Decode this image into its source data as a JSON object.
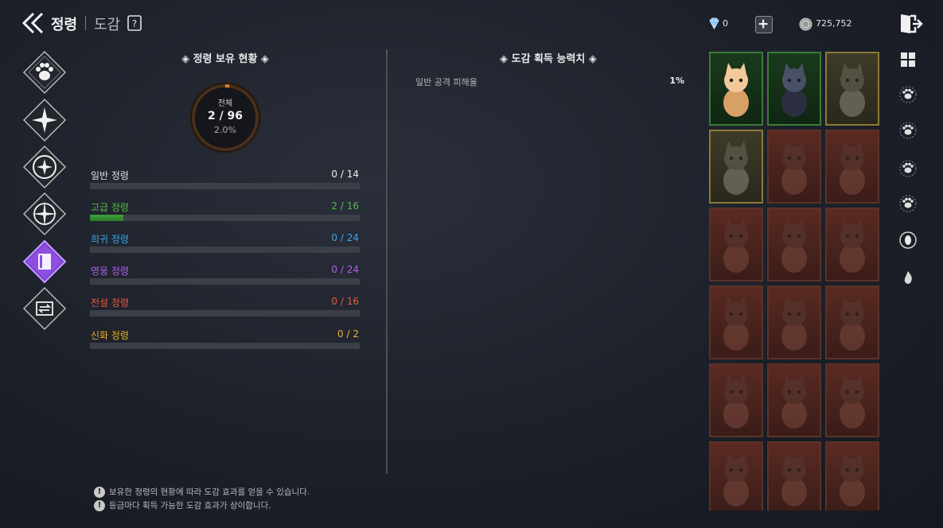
{
  "header": {
    "title": "정령",
    "subtitle": "도감",
    "gem_value": "0",
    "coin_value": "725,752"
  },
  "categories": [
    {
      "name": "paw"
    },
    {
      "name": "star"
    },
    {
      "name": "circle-star"
    },
    {
      "name": "compass"
    },
    {
      "name": "codex",
      "active": true
    },
    {
      "name": "exchange"
    }
  ],
  "left_panel": {
    "title": "정령 보유 현황",
    "ring": {
      "label": "전체",
      "count": "2 / 96",
      "percent": "2.0%",
      "owned": 2,
      "total": 96
    },
    "grades": [
      {
        "name": "일반 정령",
        "count": "0 / 14",
        "owned": 0,
        "total": 14,
        "color": "#e0e0e0"
      },
      {
        "name": "고급 정령",
        "count": "2 / 16",
        "owned": 2,
        "total": 16,
        "color": "#58b846"
      },
      {
        "name": "희귀 정령",
        "count": "0 / 24",
        "owned": 0,
        "total": 24,
        "color": "#3aa7e8"
      },
      {
        "name": "영웅 정령",
        "count": "0 / 24",
        "owned": 0,
        "total": 24,
        "color": "#b061f0"
      },
      {
        "name": "전설 정령",
        "count": "0 / 16",
        "owned": 0,
        "total": 16,
        "color": "#e85a3a"
      },
      {
        "name": "신화 정령",
        "count": "0 / 2",
        "owned": 0,
        "total": 2,
        "color": "#e8b42a"
      }
    ]
  },
  "right_panel": {
    "title": "도감 획득 능력치",
    "stats": [
      {
        "label": "일반 공격 피해율",
        "value": "1%"
      }
    ]
  },
  "notes": [
    "보유한 정령의 현황에 따라 도감 효과를 얻을 수 있습니다.",
    "등급마다 획득 가능한 도감 효과가 상이합니다."
  ],
  "cards": [
    {
      "style": "owned-green",
      "creature": "lion-cub"
    },
    {
      "style": "owned-green",
      "creature": "black-cat"
    },
    {
      "style": "gold",
      "creature": "lion"
    },
    {
      "style": "gold",
      "creature": "dragon"
    },
    {
      "style": "red",
      "creature": "fox-mask"
    },
    {
      "style": "red",
      "creature": "forest-cat"
    },
    {
      "style": "red",
      "creature": "blue-beast"
    },
    {
      "style": "red",
      "creature": "rabbit"
    },
    {
      "style": "red",
      "creature": "lynx"
    },
    {
      "style": "red",
      "creature": "fish"
    },
    {
      "style": "red",
      "creature": "pufferfish"
    },
    {
      "style": "red",
      "creature": "shadow-cat"
    },
    {
      "style": "red",
      "creature": "blue-cat"
    },
    {
      "style": "red",
      "creature": "dino"
    },
    {
      "style": "red",
      "creature": "owl"
    },
    {
      "style": "red",
      "creature": "fox"
    },
    {
      "style": "red",
      "creature": "wolf"
    },
    {
      "style": "red",
      "creature": "demon-cat"
    }
  ],
  "right_nav": [
    "grid-icon",
    "paw-all-icon",
    "paw-icon",
    "claw-icon",
    "paw-drop-icon",
    "egg-icon",
    "flame-icon"
  ]
}
